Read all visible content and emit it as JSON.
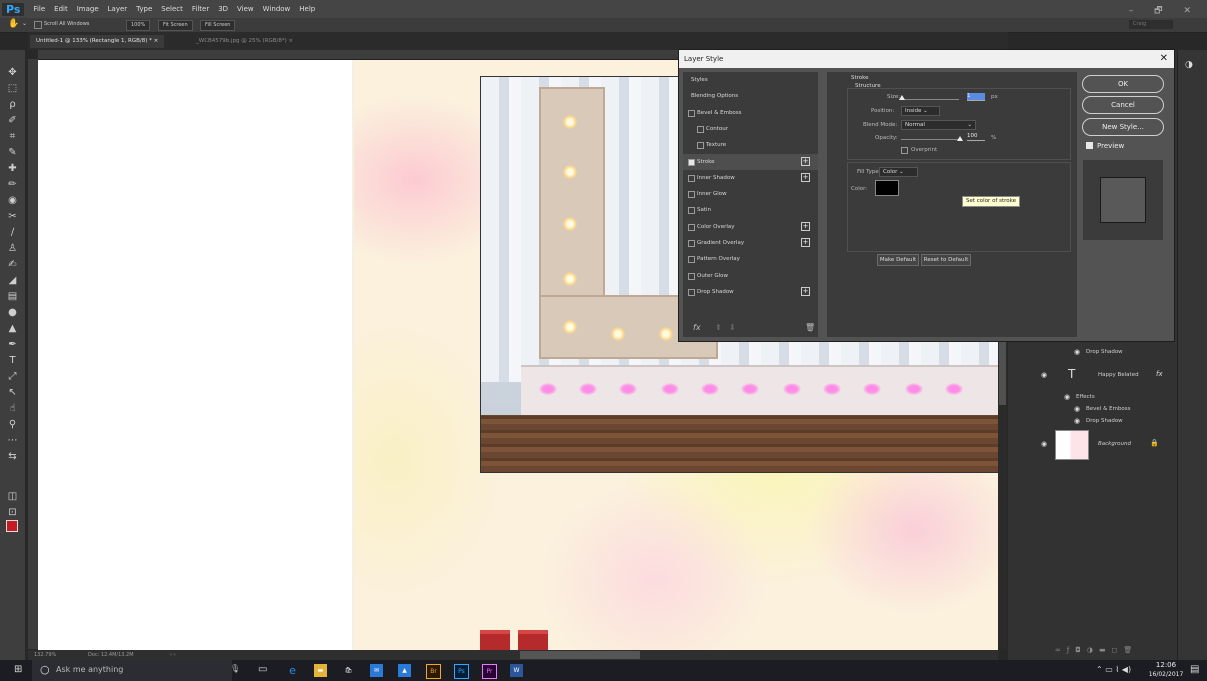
{
  "app": {
    "logo": "Ps"
  },
  "menubar": {
    "items": [
      "File",
      "Edit",
      "Image",
      "Layer",
      "Type",
      "Select",
      "Filter",
      "3D",
      "View",
      "Window",
      "Help"
    ]
  },
  "options_bar": {
    "scroll_all": "Scroll All Windows",
    "zoom": "100%",
    "fit1": "Fit Screen",
    "fit2": "Fill Screen",
    "workspace": "Craig"
  },
  "tabs": [
    {
      "label": "Untitled-1 @ 133% (Rectangle 1, RGB/8) * ×",
      "active": true
    },
    {
      "label": "_WCB4579b.jpg @ 25% (RGB/8*) ×",
      "active": false
    }
  ],
  "status": {
    "zoom": "132.79%",
    "doc": "Doc: 12.4M/13.2M",
    "arrow": "›  ‹"
  },
  "dialog": {
    "title": "Layer Style",
    "close": "✕",
    "styles_list": [
      {
        "label": "Styles",
        "checkbox": false,
        "plus": false,
        "checked": false
      },
      {
        "label": "Blending Options",
        "checkbox": false,
        "plus": false,
        "checked": false
      },
      {
        "label": "Bevel & Emboss",
        "checkbox": true,
        "plus": false,
        "checked": false
      },
      {
        "label": "Contour",
        "checkbox": true,
        "plus": false,
        "checked": false,
        "indent": true
      },
      {
        "label": "Texture",
        "checkbox": true,
        "plus": false,
        "checked": false,
        "indent": true
      },
      {
        "label": "Stroke",
        "checkbox": true,
        "plus": true,
        "checked": true
      },
      {
        "label": "Inner Shadow",
        "checkbox": true,
        "plus": true,
        "checked": false
      },
      {
        "label": "Inner Glow",
        "checkbox": true,
        "plus": false,
        "checked": false
      },
      {
        "label": "Satin",
        "checkbox": true,
        "plus": false,
        "checked": false
      },
      {
        "label": "Color Overlay",
        "checkbox": true,
        "plus": true,
        "checked": false
      },
      {
        "label": "Gradient Overlay",
        "checkbox": true,
        "plus": true,
        "checked": false
      },
      {
        "label": "Pattern Overlay",
        "checkbox": true,
        "plus": false,
        "checked": false
      },
      {
        "label": "Outer Glow",
        "checkbox": true,
        "plus": false,
        "checked": false
      },
      {
        "label": "Drop Shadow",
        "checkbox": true,
        "plus": true,
        "checked": false
      }
    ],
    "fx": "fx",
    "stroke": {
      "heading": "Stroke",
      "structure": "Structure",
      "size_label": "Size:",
      "size_value": "1",
      "size_unit": "px",
      "position_label": "Position:",
      "position_value": "Inside",
      "blend_label": "Blend Mode:",
      "blend_value": "Normal",
      "opacity_label": "Opacity:",
      "opacity_value": "100",
      "opacity_unit": "%",
      "overprint": "Overprint",
      "fill_type_label": "Fill Type:",
      "fill_type_value": "Color",
      "color_label": "Color:",
      "tooltip": "Set color of stroke",
      "make_default": "Make Default",
      "reset_default": "Reset to Default",
      "stroke_color": "#000000"
    },
    "buttons": {
      "ok": "OK",
      "cancel": "Cancel",
      "new_style": "New Style...",
      "preview": "Preview"
    }
  },
  "layers": {
    "partial_top": "Bevel & Emboss",
    "items": [
      {
        "label": "Drop Shadow"
      },
      {
        "label": "Happy Belated"
      },
      {
        "label": "Effects"
      },
      {
        "label": "Bevel & Emboss"
      },
      {
        "label": "Drop Shadow"
      },
      {
        "label": "Background"
      }
    ],
    "text_glyph": "T",
    "fx_glyph": "fx"
  },
  "taskbar": {
    "search": "Ask me anything",
    "time": "12:06",
    "date": "16/02/2017"
  }
}
